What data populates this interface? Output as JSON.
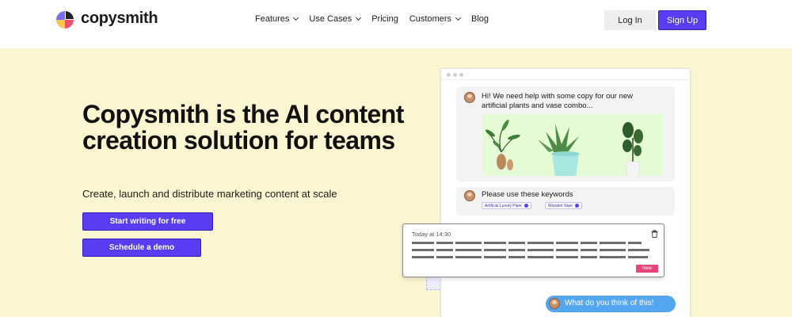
{
  "brand": {
    "name": "copysmith",
    "colors": {
      "primary": "#5a3df2",
      "hero_bg": "#fcf5d2",
      "badge": "#e9447a",
      "reply": "#55a6f0"
    }
  },
  "nav": {
    "links": [
      {
        "label": "Features",
        "dropdown": true
      },
      {
        "label": "Use Cases",
        "dropdown": true
      },
      {
        "label": "Pricing",
        "dropdown": false
      },
      {
        "label": "Customers",
        "dropdown": true
      },
      {
        "label": "Blog",
        "dropdown": false
      }
    ],
    "login_label": "Log In",
    "signup_label": "Sign Up"
  },
  "hero": {
    "headline": "Copysmith is the AI content creation solution for teams",
    "subheadline": "Create, launch and distribute marketing content at scale",
    "cta_primary": "Start writing for free",
    "cta_secondary": "Schedule a demo"
  },
  "mockup": {
    "message1": "Hi! We need help with some copy for our new artificial plants and vase combo...",
    "message2": "Please use these keywords",
    "keywords": [
      "Artificial Luxury Plant",
      "Wooden Vase"
    ],
    "result_time": "Today at 14:30",
    "result_badge": "New",
    "reply": "What do you think of this!",
    "icons": [
      "trash-icon",
      "remove-keyword-icon",
      "chevron-down-icon"
    ]
  }
}
